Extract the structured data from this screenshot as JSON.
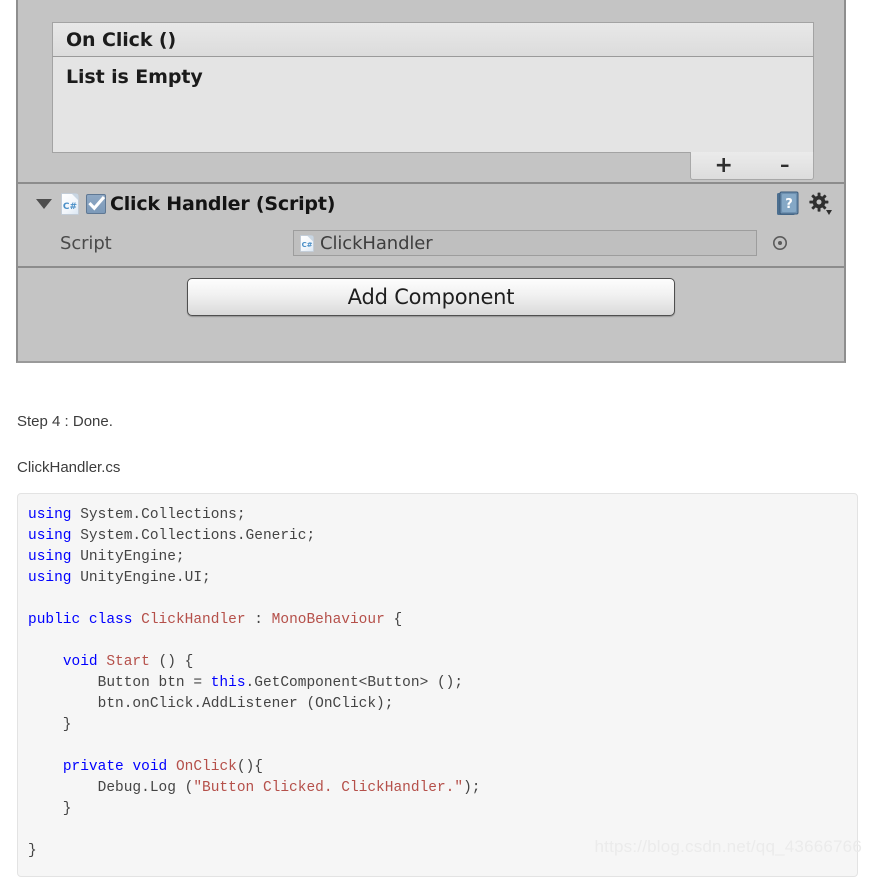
{
  "inspector": {
    "partial_field_name": "cut-off-object-field",
    "event_list": {
      "header_label": "On Click ()",
      "empty_label": "List is Empty",
      "add_label": "+",
      "remove_label": "–"
    },
    "component": {
      "foldout_state": "expanded",
      "enabled": true,
      "icon_label": "C#",
      "title": "Click Handler (Script)",
      "help_icon": "help-book-icon",
      "gear_icon": "gear-preset-icon",
      "properties": [
        {
          "label": "Script",
          "value": "ClickHandler",
          "value_icon_label": "C#",
          "picker_icon": "object-picker-target-icon"
        }
      ]
    },
    "add_component_label": "Add Component"
  },
  "article": {
    "step_text": "Step 4 : Done.",
    "filename_text": "ClickHandler.cs"
  },
  "code": {
    "language": "csharp",
    "colors": {
      "keyword": "#0000ff",
      "type": "#b5504a",
      "string": "#b5504a",
      "plain": "#444444",
      "background": "#f6f6f6",
      "border": "#e3e3e3"
    },
    "lines": [
      [
        {
          "t": "using",
          "c": "kw"
        },
        {
          "t": " System.Collections;",
          "c": "pl"
        }
      ],
      [
        {
          "t": "using",
          "c": "kw"
        },
        {
          "t": " System.Collections.Generic;",
          "c": "pl"
        }
      ],
      [
        {
          "t": "using",
          "c": "kw"
        },
        {
          "t": " UnityEngine;",
          "c": "pl"
        }
      ],
      [
        {
          "t": "using",
          "c": "kw"
        },
        {
          "t": " UnityEngine.UI;",
          "c": "pl"
        }
      ],
      [],
      [
        {
          "t": "public",
          "c": "kw"
        },
        {
          "t": " ",
          "c": "pl"
        },
        {
          "t": "class",
          "c": "kw"
        },
        {
          "t": " ",
          "c": "pl"
        },
        {
          "t": "ClickHandler",
          "c": "type"
        },
        {
          "t": " : ",
          "c": "pl"
        },
        {
          "t": "MonoBehaviour",
          "c": "type"
        },
        {
          "t": " {",
          "c": "pl"
        }
      ],
      [],
      [
        {
          "t": "    ",
          "c": "pl"
        },
        {
          "t": "void",
          "c": "kw"
        },
        {
          "t": " ",
          "c": "pl"
        },
        {
          "t": "Start",
          "c": "type"
        },
        {
          "t": " () {",
          "c": "pl"
        }
      ],
      [
        {
          "t": "        Button btn = ",
          "c": "pl"
        },
        {
          "t": "this",
          "c": "kw"
        },
        {
          "t": ".GetComponent<Button> ();",
          "c": "pl"
        }
      ],
      [
        {
          "t": "        btn.onClick.AddListener (OnClick);",
          "c": "pl"
        }
      ],
      [
        {
          "t": "    }",
          "c": "pl"
        }
      ],
      [],
      [
        {
          "t": "    ",
          "c": "pl"
        },
        {
          "t": "private",
          "c": "kw"
        },
        {
          "t": " ",
          "c": "pl"
        },
        {
          "t": "void",
          "c": "kw"
        },
        {
          "t": " ",
          "c": "pl"
        },
        {
          "t": "OnClick",
          "c": "type"
        },
        {
          "t": "(){",
          "c": "pl"
        }
      ],
      [
        {
          "t": "        Debug.Log (",
          "c": "pl"
        },
        {
          "t": "\"Button Clicked. ClickHandler.\"",
          "c": "str"
        },
        {
          "t": ");",
          "c": "pl"
        }
      ],
      [
        {
          "t": "    }",
          "c": "pl"
        }
      ],
      [],
      [
        {
          "t": "}",
          "c": "pl"
        }
      ]
    ]
  },
  "watermark": {
    "text": "https://blog.csdn.net/qq_43666766"
  }
}
